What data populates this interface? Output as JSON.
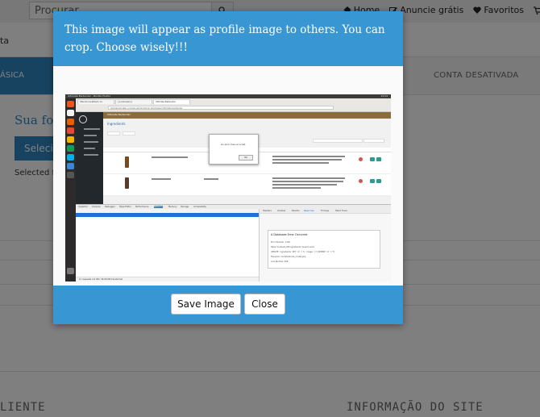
{
  "topbar": {
    "search_placeholder": "Procurar",
    "nav": [
      {
        "icon": "home-icon",
        "label": "Home"
      },
      {
        "icon": "edit-icon",
        "label": "Anuncie grátis"
      },
      {
        "icon": "heart-icon",
        "label": "Favoritos"
      }
    ]
  },
  "background": {
    "breadcrumb_fragment": "ta",
    "tab_active_fragment": "ÁSICA",
    "tab_disabled": "CONTA DESATIVADA",
    "section_title_fragment": "Sua fot",
    "select_button_fragment": "Selecio",
    "selected_text_fragment": "Selected fi",
    "footer_left": "LIENTE",
    "footer_right": "INFORMAÇÃO DO SITE"
  },
  "modal": {
    "title": "This image will appear as profile image to others. You can crop. Choose wisely!!!",
    "save_label": "Save Image",
    "close_label": "Close"
  },
  "preview": {
    "os_bar_title": "Ultimate Bartender - Mozilla Firefox",
    "clock": "14:54",
    "browser_tabs": [
      "Ubuntu Localhost / Lo",
      "{{unknown}}",
      "Ultimate Bartender"
    ],
    "url": "gnbhackyhdssk.com/wp-admin/admin.php?page=ultimate-bartender",
    "wp_site_name": "Ultimate Bartender",
    "wp_page_heading": "Ingredients",
    "alert_message": "An error has occurred.",
    "alert_ok": "OK",
    "devtools_tabs": [
      "Inspector",
      "Console",
      "Debugger",
      "Style Editor",
      "Performance",
      "Network",
      "Memory",
      "Storage",
      "Accessibility"
    ],
    "network_status": "11 requests  4.2 KB / 39.99 KB transferred",
    "response_tabs": [
      "Headers",
      "Cookies",
      "Params",
      "Response",
      "Timings",
      "Stack Trace"
    ],
    "error_title": "A Database Error Occurred",
    "error_lines": [
      "Error Number: 1146",
      "Table 'Contests_DB.ingredients' doesn't exist",
      "UPDATE `ingredients` SET `id` = 5, `image` = 5 WHERE `id` = '5'",
      "Filename: models/Drinks_model.php",
      "Line Number: 466"
    ]
  }
}
